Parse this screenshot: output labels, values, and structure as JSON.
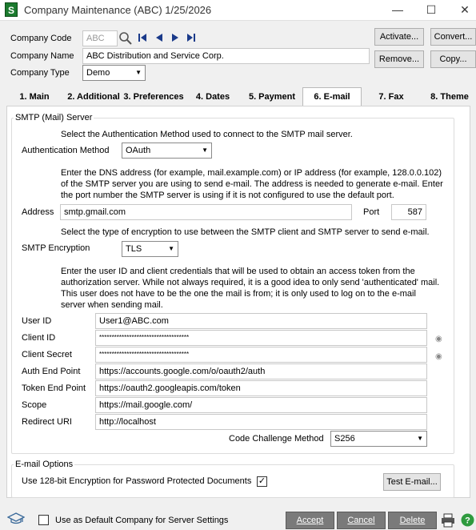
{
  "window": {
    "app_icon": "S",
    "title": "Company Maintenance (ABC) 1/25/2026",
    "minimize": "—",
    "maximize": "☐",
    "close": "✕"
  },
  "header": {
    "company_code_label": "Company Code",
    "company_code_value": "ABC",
    "company_name_label": "Company Name",
    "company_name_value": "ABC Distribution and Service Corp.",
    "company_type_label": "Company Type",
    "company_type_value": "Demo",
    "activate_button": "Activate...",
    "convert_button": "Convert...",
    "remove_button": "Remove...",
    "copy_button": "Copy..."
  },
  "tabs": [
    {
      "label": "1. Main"
    },
    {
      "label": "2. Additional"
    },
    {
      "label": "3. Preferences"
    },
    {
      "label": "4. Dates"
    },
    {
      "label": "5. Payment"
    },
    {
      "label": "6. E-mail"
    },
    {
      "label": "7. Fax"
    },
    {
      "label": "8. Theme"
    }
  ],
  "smtp": {
    "group_title": "SMTP (Mail) Server",
    "auth_intro": "Select the Authentication Method used to connect to the SMTP mail server.",
    "auth_method_label": "Authentication Method",
    "auth_method_value": "OAuth",
    "dns_text_1": "Enter the DNS address (for example, mail.example.com) or IP address (for example, 128.0.0.102)",
    "dns_text_2": "of the SMTP server you are using to send e-mail. The address is needed to generate e-mail. Enter",
    "dns_text_3": "the port number the SMTP server is using if it is not configured to use the default port.",
    "address_label": "Address",
    "address_value": "smtp.gmail.com",
    "port_label": "Port",
    "port_value": "587",
    "encryption_intro": "Select the type of encryption to use between the SMTP client and SMTP server to send e-mail.",
    "encryption_label": "SMTP Encryption",
    "encryption_value": "TLS",
    "user_text_1": "Enter the user ID and client credentials that will be used to obtain an access token from the",
    "user_text_2": "authorization server. While not always required, it is a good idea to only send 'authenticated' mail.",
    "user_text_3": "This user does not have to be the one the mail is from; it is only used to log on to the e-mail",
    "user_text_4": "server when sending mail.",
    "user_id_label": "User ID",
    "user_id_value": "User1@ABC.com",
    "client_id_label": "Client ID",
    "client_id_value": "************************************",
    "client_secret_label": "Client Secret",
    "client_secret_value": "************************************",
    "auth_end_point_label": "Auth End Point",
    "auth_end_point_value": "https://accounts.google.com/o/oauth2/auth",
    "token_end_point_label": "Token End Point",
    "token_end_point_value": "https://oauth2.googleapis.com/token",
    "scope_label": "Scope",
    "scope_value": "https://mail.google.com/",
    "redirect_uri_label": "Redirect URI",
    "redirect_uri_value": "http://localhost",
    "code_challenge_label": "Code Challenge Method",
    "code_challenge_value": "S256"
  },
  "email_options": {
    "group_title": "E-mail Options",
    "encryption_checkbox_label": "Use 128-bit Encryption for Password Protected Documents",
    "encryption_checked": true,
    "test_email_button": "Test E-mail..."
  },
  "footer": {
    "default_company_label": "Use as Default Company for Server Settings",
    "accept_button": "Accept",
    "cancel_button": "Cancel",
    "delete_button": "Delete"
  },
  "icons": {
    "search": "search-icon",
    "first": "first-record-icon",
    "prev": "previous-record-icon",
    "next": "next-record-icon",
    "last": "last-record-icon",
    "eye": "show-password-icon",
    "print": "printer-icon",
    "help": "help-icon",
    "training": "graduation-cap-icon"
  },
  "colors": {
    "app_icon_bg": "#1b7a2e",
    "nav_blue": "#1a3a8a",
    "help_green": "#2e9a3e",
    "footer_button_bg": "#7a7a7a"
  }
}
